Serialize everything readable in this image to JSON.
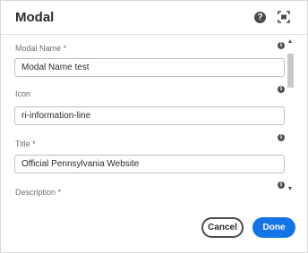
{
  "dialog": {
    "title": "Modal",
    "help_icon": "help-icon",
    "fullscreen_icon": "fullscreen-icon"
  },
  "fields": [
    {
      "label": "Modal Name *",
      "value": "Modal Name test",
      "info_icon": "info-icon"
    },
    {
      "label": "Icon",
      "value": "ri-information-line",
      "info_icon": "info-icon"
    },
    {
      "label": "Title *",
      "value": "Official Pennsylvania Website",
      "info_icon": "info-icon"
    },
    {
      "label": "Description *",
      "value": "",
      "info_icon": "info-icon"
    }
  ],
  "footer": {
    "cancel_label": "Cancel",
    "done_label": "Done"
  },
  "colors": {
    "primary": "#1473e6",
    "text": "#2c2c2c",
    "label": "#6e6e6e"
  }
}
